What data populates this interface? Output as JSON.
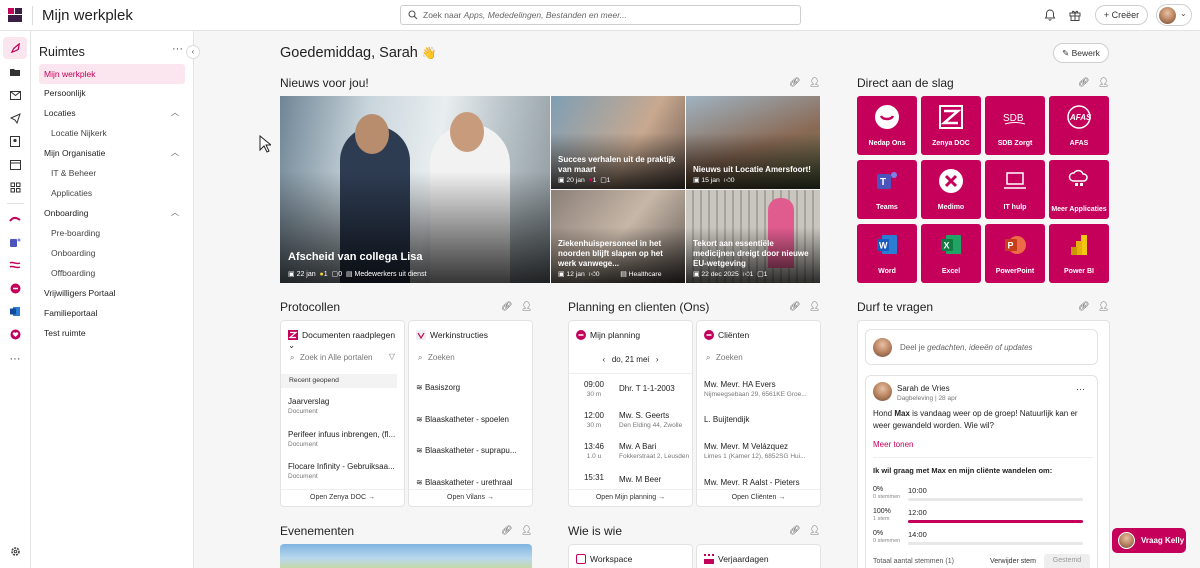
{
  "app": {
    "title": "Mijn werkplek",
    "brand_color": "#c4005a"
  },
  "search": {
    "placeholder_prefix": "Zoek naar ",
    "placeholder_rest": "Apps, Mededelingen, Bestanden en meer..."
  },
  "topbar": {
    "create_label": "+ Creëer"
  },
  "sidebar": {
    "title": "Ruimtes",
    "more": "···",
    "items": [
      {
        "label": "Mijn werkplek"
      },
      {
        "label": "Persoonlijk"
      },
      {
        "label": "Locaties"
      },
      {
        "label": "Locatie Nijkerk"
      },
      {
        "label": "Mijn Organisatie"
      },
      {
        "label": "IT & Beheer"
      },
      {
        "label": "Applicaties"
      },
      {
        "label": "Onboarding"
      },
      {
        "label": "Pre-boarding"
      },
      {
        "label": "Onboarding"
      },
      {
        "label": "Offboarding"
      },
      {
        "label": "Vrijwilligers Portaal"
      },
      {
        "label": "Familieportaal"
      },
      {
        "label": "Test ruimte"
      }
    ]
  },
  "main": {
    "greeting": "Goedemiddag, Sarah",
    "greeting_emoji": "👋",
    "edit_label": "Bewerk"
  },
  "news": {
    "title": "Nieuws voor jou!",
    "items": [
      {
        "title": "Afscheid van collega Lisa",
        "date": "22 jan",
        "likes": "1",
        "comments": "0",
        "tag": "Medewerkers uit dienst"
      },
      {
        "title": "Succes verhalen uit de praktijk van maart",
        "date": "20 jan",
        "likes": "1",
        "comments": "1"
      },
      {
        "title": "Nieuws uit Locatie Amersfoort!",
        "date": "15 jan",
        "likes": "0"
      },
      {
        "title": "Ziekenhuispersoneel in het noorden blijft slapen op het werk vanwege...",
        "date": "12 jan",
        "likes": "0",
        "tag": "Healthcare"
      },
      {
        "title": "Tekort aan essentiële medicijnen dreigt door nieuwe EU-wetgeving",
        "date": "22 dec 2025",
        "likes": "1",
        "comments": "1"
      }
    ]
  },
  "direct": {
    "title": "Direct aan de slag",
    "apps": [
      {
        "label": "Nedap Ons",
        "icon": "nedap-icon"
      },
      {
        "label": "Zenya DOC",
        "icon": "zenya-icon"
      },
      {
        "label": "SDB Zorgt",
        "icon": "sdb-icon"
      },
      {
        "label": "AFAS",
        "icon": "afas-icon"
      },
      {
        "label": "Teams",
        "icon": "teams-icon"
      },
      {
        "label": "Medimo",
        "icon": "medimo-icon"
      },
      {
        "label": "IT hulp",
        "icon": "laptop-icon"
      },
      {
        "label": "Meer Applicaties",
        "icon": "cloud-icon"
      },
      {
        "label": "Word",
        "icon": "word-icon"
      },
      {
        "label": "Excel",
        "icon": "excel-icon"
      },
      {
        "label": "PowerPoint",
        "icon": "powerpoint-icon"
      },
      {
        "label": "Power BI",
        "icon": "powerbi-icon"
      }
    ]
  },
  "protocollen": {
    "title": "Protocollen",
    "docs": {
      "header": "Documenten raadplegen",
      "search": "Zoek in Alle portalen",
      "recent": "Recent geopend",
      "items": [
        {
          "name": "Jaarverslag",
          "type": "Document"
        },
        {
          "name": "Perifeer infuus inbrengen, (fl...",
          "type": "Document"
        },
        {
          "name": "Flocare Infinity - Gebruiksaa...",
          "type": "Document"
        }
      ],
      "footer": "Open Zenya DOC"
    },
    "werk": {
      "header": "Werkinstructies",
      "search": "Zoeken",
      "items": [
        "Basiszorg",
        "Blaaskatheter - spoelen",
        "Blaaskatheter - suprapu...",
        "Blaaskatheter - urethraal"
      ],
      "footer": "Open Vilans"
    }
  },
  "planning": {
    "title": "Planning en clienten (Ons)",
    "mijn": {
      "header": "Mijn planning",
      "date": "do, 21 mei",
      "items": [
        {
          "time": "09:00",
          "dur": "30 m",
          "name": "Dhr. T 1-1-2003",
          "addr": ""
        },
        {
          "time": "12:00",
          "dur": "30 m",
          "name": "Mw. S. Geerts",
          "addr": "Den Elding 44, Zwolle"
        },
        {
          "time": "13:46",
          "dur": "1.0 u",
          "name": "Mw. A Bari",
          "addr": "Fokkerstraat 2, Leusden"
        },
        {
          "time": "15:31",
          "dur": "",
          "name": "Mw. M Beer",
          "addr": ""
        }
      ],
      "footer": "Open Mijn planning"
    },
    "clienten": {
      "header": "Cliënten",
      "search": "Zoeken",
      "items": [
        {
          "name": "Mw. Mevr. HA Evers",
          "addr": "Nijmeegsebaan 29, 6561KE Groe..."
        },
        {
          "name": "L. Buijtendijk",
          "addr": ""
        },
        {
          "name": "Mw. Mevr. M Velázquez",
          "addr": "Limes 1 (Kamer 12), 6852SG Hui..."
        },
        {
          "name": "Mw. Mevr. R Aalst - Pieters",
          "addr": ""
        }
      ],
      "footer": "Open Cliënten"
    }
  },
  "durf": {
    "title": "Durf te vragen",
    "share_prefix": "Deel je ",
    "share_rest": "gedachten, ideeën of updates",
    "post": {
      "author": "Sarah de Vries",
      "sub": "Dagbeleving | 28 apr",
      "text_a": "Hond ",
      "text_b": "Max",
      "text_c": " is vandaag weer op de groep! Natuurlijk kan er weer gewandeld worden. Wie wil?",
      "more": "Meer tonen",
      "question": "Ik wil graag met Max en mijn cliënte wandelen om:",
      "options": [
        {
          "pct": "0%",
          "votes": "0 stemmen",
          "time": "10:00",
          "value": 0
        },
        {
          "pct": "100%",
          "votes": "1 stem",
          "time": "12:00",
          "value": 1
        },
        {
          "pct": "0%",
          "votes": "0 stemmen",
          "time": "14:00",
          "value": 0
        }
      ],
      "total": "Totaal aantal stemmen (1)",
      "remove": "Verwijder stem",
      "voted": "Gestemd"
    }
  },
  "evenementen": {
    "title": "Evenementen"
  },
  "wieiswie": {
    "title": "Wie is wie",
    "tab1": "Workspace",
    "tab2": "Verjaardagen"
  },
  "chat": {
    "label": "Vraag Kelly"
  }
}
